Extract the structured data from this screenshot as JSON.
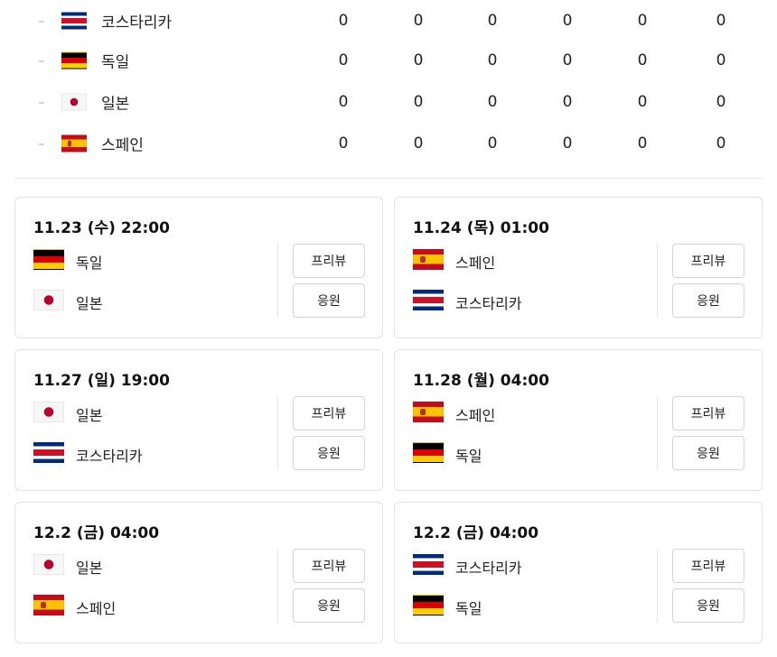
{
  "standings": {
    "rows": [
      {
        "team": "코스타리카",
        "flag": "flag-cr",
        "dash": "–",
        "stats": [
          "0",
          "0",
          "0",
          "0",
          "0",
          "0"
        ]
      },
      {
        "team": "독일",
        "flag": "flag-de",
        "dash": "–",
        "stats": [
          "0",
          "0",
          "0",
          "0",
          "0",
          "0"
        ]
      },
      {
        "team": "일본",
        "flag": "flag-jp",
        "dash": "–",
        "stats": [
          "0",
          "0",
          "0",
          "0",
          "0",
          "0"
        ]
      },
      {
        "team": "스페인",
        "flag": "flag-es",
        "dash": "–",
        "stats": [
          "0",
          "0",
          "0",
          "0",
          "0",
          "0"
        ]
      }
    ]
  },
  "matches": [
    {
      "date": "11.23 (수) 22:00",
      "home": {
        "name": "독일",
        "flag": "flag-de"
      },
      "away": {
        "name": "일본",
        "flag": "flag-jp"
      },
      "preview_label": "프리뷰",
      "cheer_label": "응원"
    },
    {
      "date": "11.24 (목) 01:00",
      "home": {
        "name": "스페인",
        "flag": "flag-es"
      },
      "away": {
        "name": "코스타리카",
        "flag": "flag-cr"
      },
      "preview_label": "프리뷰",
      "cheer_label": "응원"
    },
    {
      "date": "11.27 (일) 19:00",
      "home": {
        "name": "일본",
        "flag": "flag-jp"
      },
      "away": {
        "name": "코스타리카",
        "flag": "flag-cr"
      },
      "preview_label": "프리뷰",
      "cheer_label": "응원"
    },
    {
      "date": "11.28 (월) 04:00",
      "home": {
        "name": "스페인",
        "flag": "flag-es"
      },
      "away": {
        "name": "독일",
        "flag": "flag-de"
      },
      "preview_label": "프리뷰",
      "cheer_label": "응원"
    },
    {
      "date": "12.2 (금) 04:00",
      "home": {
        "name": "일본",
        "flag": "flag-jp"
      },
      "away": {
        "name": "스페인",
        "flag": "flag-es"
      },
      "preview_label": "프리뷰",
      "cheer_label": "응원"
    },
    {
      "date": "12.2 (금) 04:00",
      "home": {
        "name": "코스타리카",
        "flag": "flag-cr"
      },
      "away": {
        "name": "독일",
        "flag": "flag-de"
      },
      "preview_label": "프리뷰",
      "cheer_label": "응원"
    }
  ]
}
